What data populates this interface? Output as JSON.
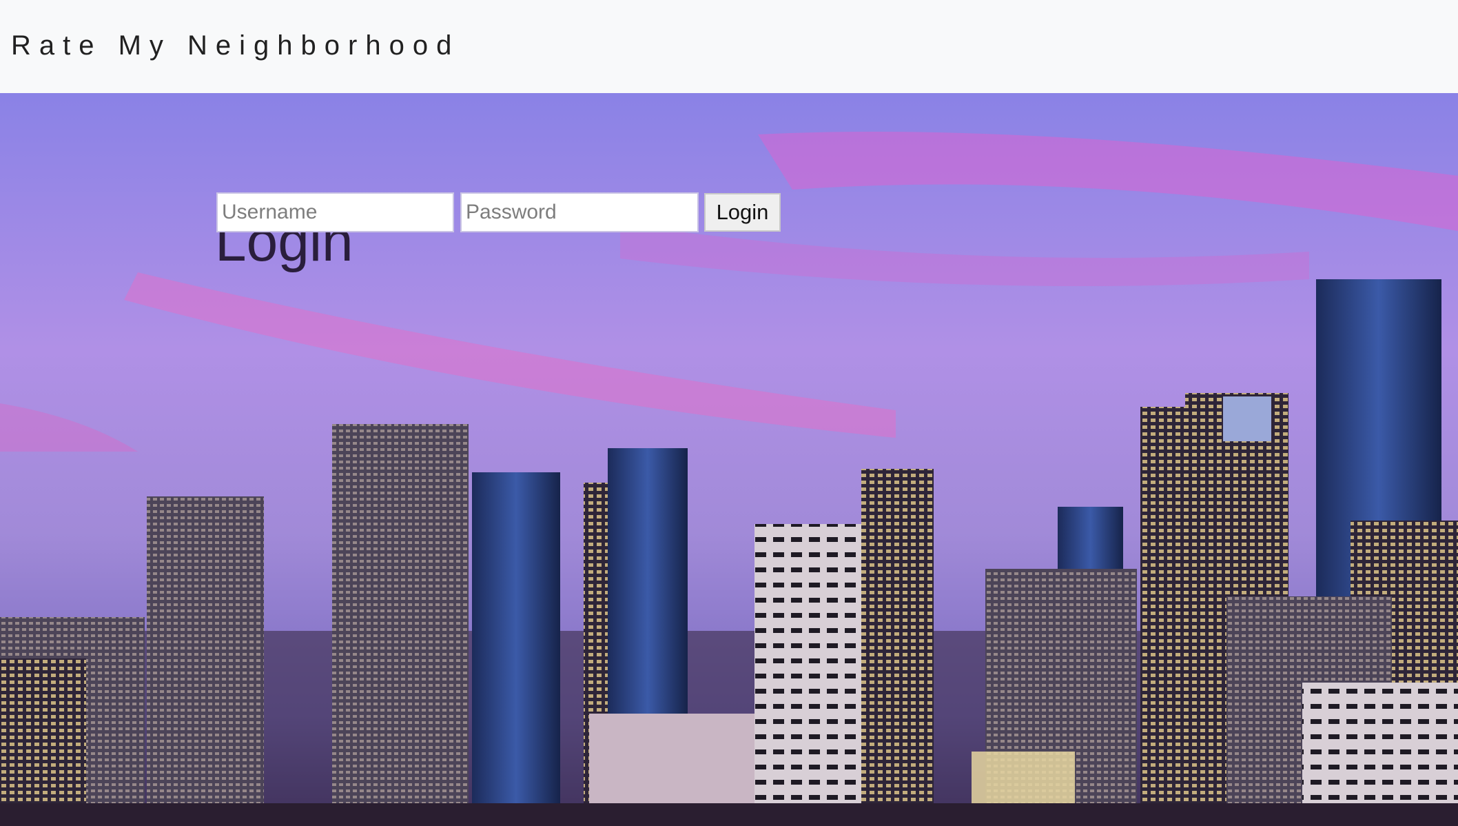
{
  "navbar": {
    "brand": "Rate My Neighborhood"
  },
  "login": {
    "title": "Login",
    "username_placeholder": "Username",
    "password_placeholder": "Password",
    "submit_label": "Login"
  },
  "hero": {
    "image": "city-skyline-at-dusk",
    "sky_colors": [
      "#8b7de8",
      "#c46ad4",
      "#a98ae8"
    ]
  }
}
